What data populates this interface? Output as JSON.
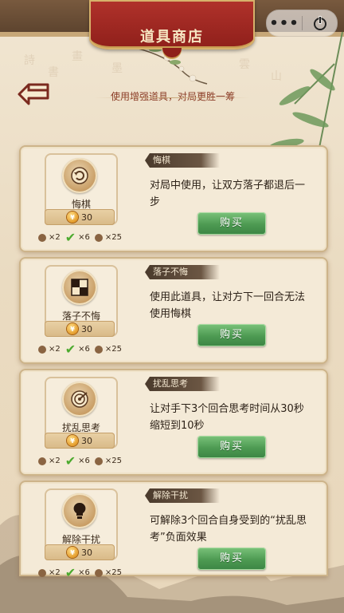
{
  "header": {
    "title": "道具商店",
    "more_icon": "more-dots-icon",
    "power_icon": "power-icon"
  },
  "subtitle": "使用增强道具，对局更胜一筹",
  "colors": {
    "banner": "#a02a24",
    "buy": "#4d9a52",
    "card_bg": "#f4ead7"
  },
  "items": [
    {
      "name": "悔棋",
      "label": "悔棋",
      "icon": "undo-icon",
      "price": "30",
      "desc": "对局中使用，让双方落子都退后一步",
      "qty": [
        "×2",
        "×6",
        "×25"
      ],
      "buy_label": "购买"
    },
    {
      "name": "落子不悔",
      "label": "落子不悔",
      "icon": "checker-block-icon",
      "price": "30",
      "desc": "使用此道具，让对方下一回合无法使用悔棋",
      "qty": [
        "×2",
        "×6",
        "×25"
      ],
      "buy_label": "购买"
    },
    {
      "name": "扰乱思考",
      "label": "扰乱思考",
      "icon": "target-icon",
      "price": "30",
      "desc": "让对手下3个回合思考时间从30秒缩短到10秒",
      "qty": [
        "×2",
        "×6",
        "×25"
      ],
      "buy_label": "购买"
    },
    {
      "name": "解除干扰",
      "label": "解除干扰",
      "icon": "lightbulb-icon",
      "price": "30",
      "desc": "可解除3个回合自身受到的“扰乱思考”负面效果",
      "qty": [
        "×2",
        "×6",
        "×25"
      ],
      "buy_label": "购买"
    }
  ]
}
